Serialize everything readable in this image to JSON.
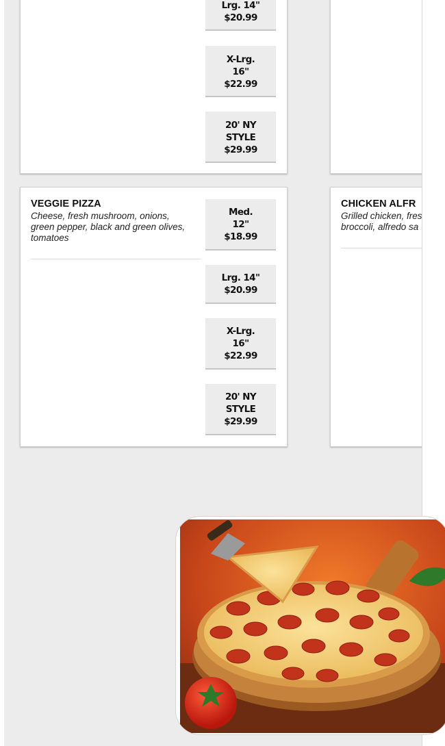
{
  "menu": {
    "top_left_card": {
      "prices": [
        {
          "size": "Lrg. 14\"",
          "price": "$20.99"
        },
        {
          "size": "X-Lrg. 16\"",
          "price": "$22.99"
        },
        {
          "size": "20' NY STYLE",
          "price": "$29.99"
        }
      ]
    },
    "veggie_pizza": {
      "title": "VEGGIE PIZZA",
      "description": "Cheese, fresh mushroom, onions, green pepper, black and green olives, tomatoes",
      "prices": [
        {
          "size": "Med. 12\"",
          "price": "$18.99"
        },
        {
          "size": "Lrg. 14\"",
          "price": "$20.99"
        },
        {
          "size": "X-Lrg. 16\"",
          "price": "$22.99"
        },
        {
          "size": "20' NY STYLE",
          "price": "$29.99"
        }
      ]
    },
    "chicken_alfredo": {
      "title": "CHICKEN ALFR",
      "description": "Grilled chicken, fres broccoli, alfredo sa"
    }
  },
  "images": {
    "pizza": "pepperoni-pizza-photo"
  },
  "colors": {
    "page_background": "#ececec",
    "card_background": "#ffffff",
    "price_button_background": "#ececec"
  }
}
